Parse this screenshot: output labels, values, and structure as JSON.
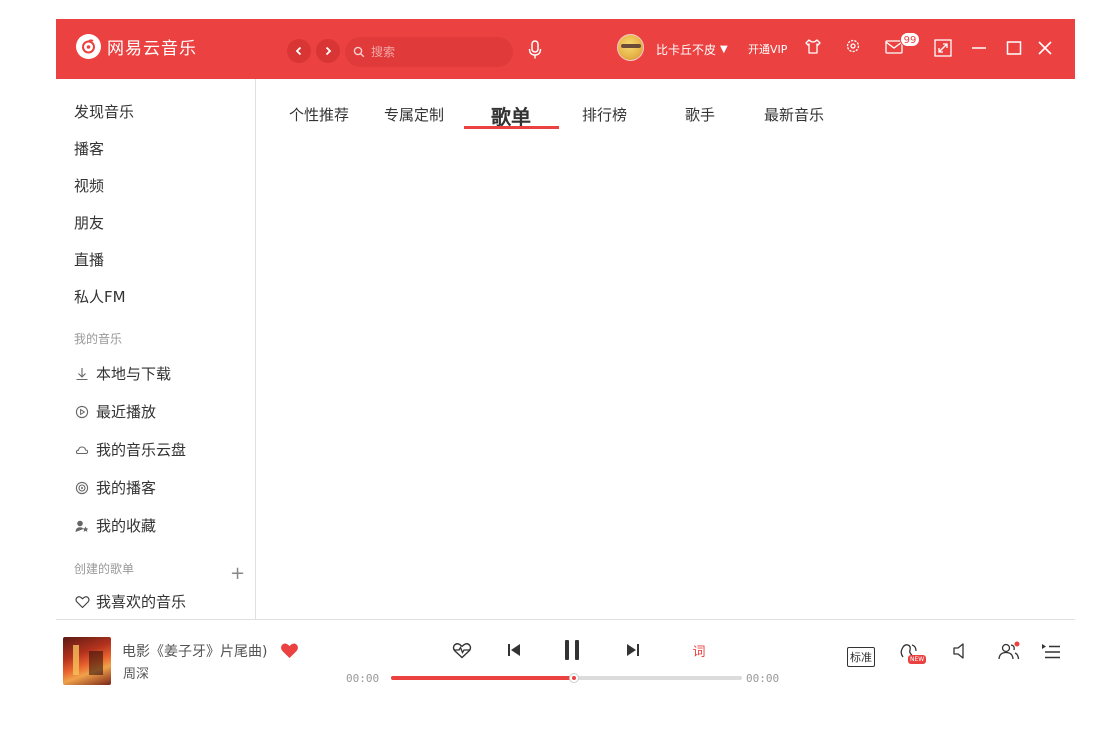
{
  "app": {
    "name": "网易云音乐"
  },
  "header": {
    "search_placeholder": "搜索",
    "username": "比卡丘不皮",
    "vip_label": "开通VIP",
    "message_count": "99",
    "icons": [
      "back-icon",
      "forward-icon",
      "search-icon",
      "mic-icon",
      "skin-icon",
      "settings-icon",
      "mail-icon",
      "mini-mode-icon",
      "minimize-icon",
      "maximize-icon",
      "close-icon"
    ]
  },
  "sidebar": {
    "main_items": [
      {
        "label": "发现音乐"
      },
      {
        "label": "播客"
      },
      {
        "label": "视频"
      },
      {
        "label": "朋友"
      },
      {
        "label": "直播"
      },
      {
        "label": "私人FM"
      }
    ],
    "my_music_title": "我的音乐",
    "my_music_items": [
      {
        "label": "本地与下载",
        "icon": "download-icon"
      },
      {
        "label": "最近播放",
        "icon": "recent-play-icon"
      },
      {
        "label": "我的音乐云盘",
        "icon": "cloud-icon"
      },
      {
        "label": "我的播客",
        "icon": "podcast-icon"
      },
      {
        "label": "我的收藏",
        "icon": "collection-icon"
      }
    ],
    "created_playlists_title": "创建的歌单",
    "created_playlists": [
      {
        "label": "我喜欢的音乐",
        "icon": "heart-outline-icon"
      }
    ]
  },
  "tabs": {
    "items": [
      {
        "label": "个性推荐"
      },
      {
        "label": "专属定制"
      },
      {
        "label": "歌单"
      },
      {
        "label": "排行榜"
      },
      {
        "label": "歌手"
      },
      {
        "label": "最新音乐"
      }
    ],
    "active": "歌单"
  },
  "player": {
    "song_title": "电影《姜子牙》片尾曲)",
    "artist": "周深",
    "current_time": "00:00",
    "total_time": "00:00",
    "progress": 0.52,
    "quality": "标准",
    "lyric_label": "词",
    "liked": true,
    "accent_color": "#ec4141"
  }
}
